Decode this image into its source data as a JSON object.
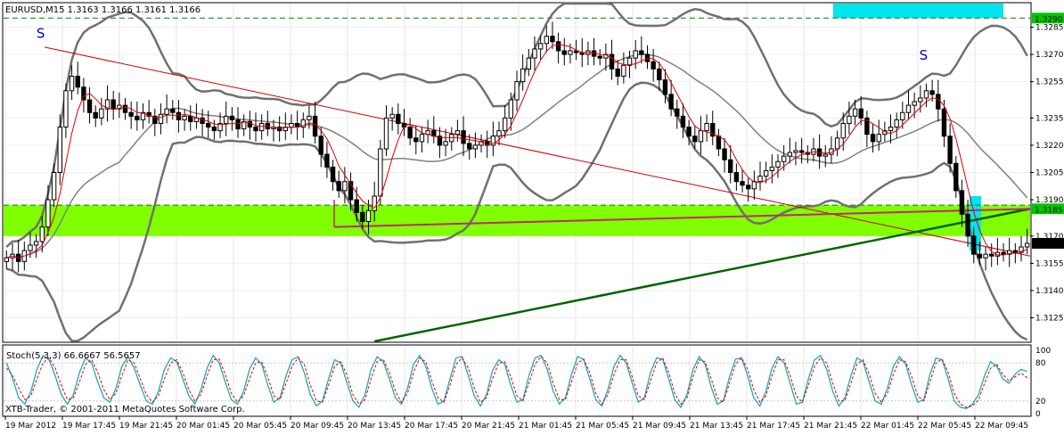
{
  "chart_data": {
    "type": "candlestick",
    "title": "EURUSD,M15  1.3163 1.3166 1.3161 1.3166",
    "footer": "XTB-Trader, © 2001-2011 MetaQuotes Software Corp.",
    "ylim": [
      1.3112,
      1.3298
    ],
    "price_ticks": [
      "1.3285",
      "1.3270",
      "1.3255",
      "1.3235",
      "1.3220",
      "1.3205",
      "1.3190",
      "1.3170",
      "1.3155",
      "1.3140",
      "1.3125"
    ],
    "price_tick_values": [
      1.3285,
      1.327,
      1.3255,
      1.3235,
      1.322,
      1.3205,
      1.319,
      1.317,
      1.3155,
      1.314,
      1.3125
    ],
    "time_ticks": [
      "19 Mar 2012",
      "19 Mar 17:45",
      "19 Mar 21:45",
      "20 Mar 01:45",
      "20 Mar 05:45",
      "20 Mar 09:45",
      "20 Mar 13:45",
      "20 Mar 17:45",
      "20 Mar 21:45",
      "21 Mar 01:45",
      "21 Mar 05:45",
      "21 Mar 09:45",
      "21 Mar 13:45",
      "21 Mar 17:45",
      "21 Mar 21:45",
      "22 Mar 01:45",
      "22 Mar 05:45",
      "22 Mar 09:45"
    ],
    "highlight_labels": [
      {
        "text": "1.3290",
        "value": 1.329,
        "color": "#00c800"
      },
      {
        "text": "1.3185",
        "value": 1.3185,
        "color": "#00c800"
      },
      {
        "text": "1.3166",
        "value": 1.3166,
        "color": "#000000"
      }
    ],
    "support_zone": [
      1.317,
      1.3187
    ],
    "annotations": [
      {
        "text": "S",
        "x": 0.032,
        "price": 1.3279
      },
      {
        "text": "S",
        "x": 0.892,
        "price": 1.3267
      }
    ],
    "candles_close": [
      1.3158,
      1.316,
      1.3156,
      1.3162,
      1.3165,
      1.3167,
      1.3175,
      1.319,
      1.3205,
      1.323,
      1.325,
      1.3258,
      1.3252,
      1.3245,
      1.3238,
      1.3235,
      1.324,
      1.3245,
      1.324,
      1.3242,
      1.3238,
      1.3236,
      1.3234,
      1.3238,
      1.3236,
      1.3232,
      1.3237,
      1.324,
      1.3238,
      1.3234,
      1.3236,
      1.3233,
      1.3235,
      1.3232,
      1.323,
      1.3228,
      1.3232,
      1.3236,
      1.3234,
      1.3229,
      1.3233,
      1.323,
      1.3228,
      1.3232,
      1.3229,
      1.323,
      1.3228,
      1.323,
      1.3232,
      1.323,
      1.3234,
      1.3236,
      1.3225,
      1.3215,
      1.3208,
      1.32,
      1.3195,
      1.32,
      1.319,
      1.3183,
      1.3178,
      1.3184,
      1.3192,
      1.3218,
      1.3235,
      1.3237,
      1.3232,
      1.323,
      1.3224,
      1.3222,
      1.3226,
      1.3228,
      1.3225,
      1.322,
      1.3222,
      1.3226,
      1.3228,
      1.3221,
      1.3218,
      1.322,
      1.3222,
      1.322,
      1.3225,
      1.3228,
      1.3235,
      1.3245,
      1.3255,
      1.3262,
      1.3268,
      1.3273,
      1.3276,
      1.328,
      1.3277,
      1.3272,
      1.327,
      1.3272,
      1.3271,
      1.327,
      1.3272,
      1.3269,
      1.3268,
      1.327,
      1.3262,
      1.3258,
      1.3264,
      1.3268,
      1.3272,
      1.327,
      1.3266,
      1.3262,
      1.3256,
      1.3248,
      1.324,
      1.3236,
      1.323,
      1.3225,
      1.3222,
      1.3228,
      1.3232,
      1.3225,
      1.3218,
      1.3212,
      1.3205,
      1.32,
      1.3198,
      1.3196,
      1.32,
      1.3203,
      1.3206,
      1.3208,
      1.3211,
      1.3214,
      1.3216,
      1.3217,
      1.3216,
      1.3215,
      1.3218,
      1.3214,
      1.3215,
      1.3218,
      1.3224,
      1.3232,
      1.3236,
      1.324,
      1.3235,
      1.3226,
      1.3222,
      1.3226,
      1.3228,
      1.323,
      1.3234,
      1.3238,
      1.3242,
      1.3244,
      1.3246,
      1.325,
      1.3248,
      1.324,
      1.3225,
      1.321,
      1.3195,
      1.3182,
      1.317,
      1.316,
      1.3158,
      1.316,
      1.3159,
      1.3161,
      1.316,
      1.3162,
      1.3161,
      1.3164,
      1.3166
    ],
    "series": [
      {
        "name": "Stoch(5,3,3)",
        "values_label": "66.6667 56.5657"
      }
    ],
    "stoch_ticks": [
      "100",
      "80",
      "20",
      "0"
    ],
    "stoch_tick_values": [
      100,
      80,
      20,
      0
    ],
    "stoch_main": [
      80,
      55,
      25,
      15,
      35,
      70,
      92,
      85,
      60,
      30,
      15,
      30,
      65,
      88,
      80,
      50,
      25,
      18,
      40,
      75,
      90,
      72,
      45,
      20,
      15,
      35,
      70,
      88,
      82,
      55,
      28,
      15,
      38,
      72,
      92,
      80,
      50,
      22,
      15,
      35,
      70,
      88,
      78,
      45,
      18,
      25,
      60,
      85,
      90,
      65,
      30,
      12,
      20,
      55,
      85,
      80,
      50,
      20,
      10,
      30,
      70,
      90,
      82,
      55,
      25,
      15,
      40,
      78,
      92,
      75,
      40,
      15,
      20,
      55,
      88,
      90,
      60,
      28,
      12,
      30,
      68,
      85,
      78,
      45,
      18,
      22,
      60,
      88,
      92,
      70,
      35,
      15,
      25,
      62,
      90,
      85,
      55,
      22,
      12,
      38,
      75,
      92,
      80,
      48,
      18,
      25,
      65,
      88,
      86,
      55,
      22,
      10,
      30,
      70,
      90,
      78,
      42,
      15,
      20,
      58,
      86,
      88,
      60,
      25,
      12,
      35,
      72,
      90,
      80,
      48,
      15,
      18,
      55,
      85,
      92,
      70,
      35,
      12,
      25,
      60,
      88,
      82,
      50,
      20,
      15,
      40,
      75,
      90,
      78,
      45,
      18,
      22,
      62,
      88,
      85,
      55,
      20,
      10,
      8,
      15,
      30,
      60,
      82,
      75,
      55,
      48,
      62,
      70,
      66.6667
    ],
    "stoch_signal": [
      72,
      60,
      40,
      22,
      28,
      55,
      80,
      88,
      72,
      45,
      22,
      25,
      50,
      78,
      85,
      65,
      38,
      22,
      32,
      60,
      85,
      80,
      55,
      30,
      18,
      28,
      55,
      80,
      85,
      65,
      38,
      20,
      30,
      60,
      85,
      86,
      62,
      32,
      18,
      28,
      55,
      80,
      82,
      58,
      28,
      22,
      48,
      75,
      88,
      78,
      45,
      20,
      18,
      45,
      75,
      82,
      62,
      30,
      15,
      22,
      55,
      82,
      86,
      65,
      35,
      18,
      32,
      65,
      88,
      82,
      52,
      25,
      18,
      45,
      78,
      88,
      72,
      40,
      18,
      25,
      55,
      80,
      82,
      58,
      28,
      20,
      48,
      78,
      90,
      80,
      48,
      22,
      22,
      50,
      80,
      86,
      65,
      32,
      15,
      30,
      62,
      85,
      85,
      58,
      28,
      22,
      52,
      80,
      88,
      65,
      32,
      15,
      25,
      58,
      85,
      82,
      55,
      25,
      18,
      48,
      78,
      88,
      70,
      38,
      18,
      28,
      60,
      85,
      85,
      60,
      28,
      18,
      45,
      75,
      88,
      80,
      48,
      20,
      20,
      48,
      78,
      85,
      62,
      32,
      18,
      32,
      62,
      85,
      82,
      58,
      28,
      20,
      50,
      80,
      86,
      65,
      32,
      15,
      10,
      12,
      22,
      48,
      72,
      78,
      62,
      52,
      58,
      64,
      56.5657
    ]
  }
}
